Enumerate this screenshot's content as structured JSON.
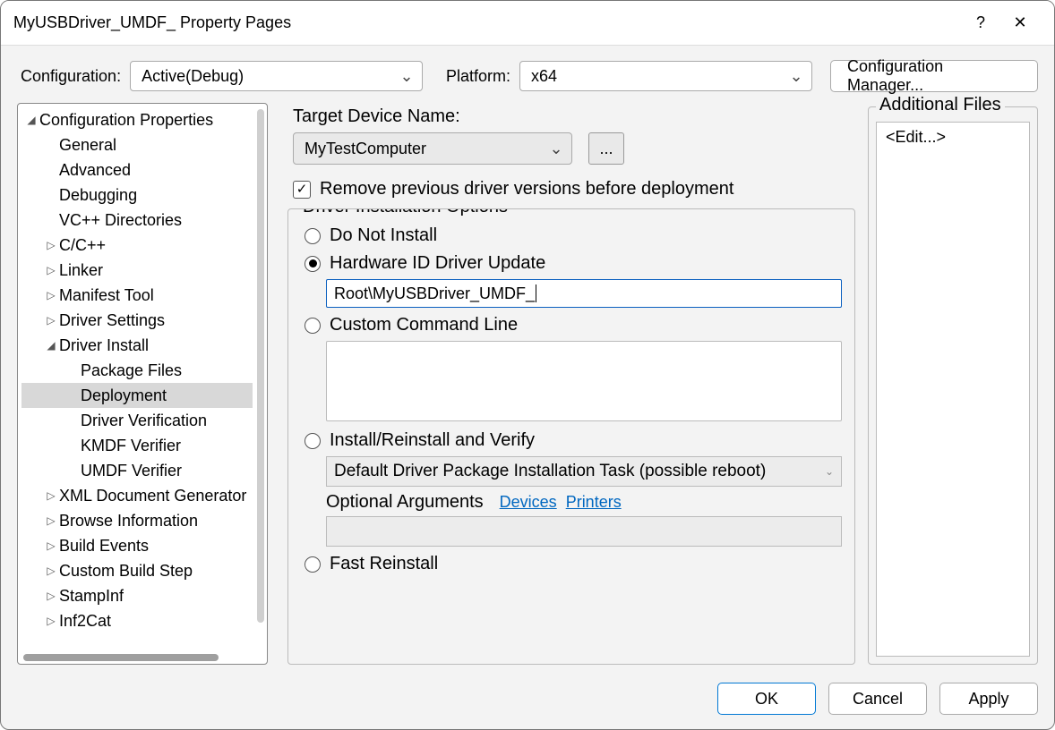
{
  "window": {
    "title": "MyUSBDriver_UMDF_ Property Pages"
  },
  "top": {
    "configuration_label": "Configuration:",
    "configuration_value": "Active(Debug)",
    "platform_label": "Platform:",
    "platform_value": "x64",
    "config_manager": "Configuration Manager..."
  },
  "tree": {
    "root": "Configuration Properties",
    "items": [
      {
        "label": "General",
        "lvl": 1,
        "exp": false,
        "leaf": true
      },
      {
        "label": "Advanced",
        "lvl": 1,
        "exp": false,
        "leaf": true
      },
      {
        "label": "Debugging",
        "lvl": 1,
        "exp": false,
        "leaf": true
      },
      {
        "label": "VC++ Directories",
        "lvl": 1,
        "exp": false,
        "leaf": true
      },
      {
        "label": "C/C++",
        "lvl": 1,
        "exp": false,
        "leaf": false
      },
      {
        "label": "Linker",
        "lvl": 1,
        "exp": false,
        "leaf": false
      },
      {
        "label": "Manifest Tool",
        "lvl": 1,
        "exp": false,
        "leaf": false
      },
      {
        "label": "Driver Settings",
        "lvl": 1,
        "exp": false,
        "leaf": false
      },
      {
        "label": "Driver Install",
        "lvl": 1,
        "exp": true,
        "leaf": false
      },
      {
        "label": "Package Files",
        "lvl": 2,
        "exp": false,
        "leaf": true
      },
      {
        "label": "Deployment",
        "lvl": 2,
        "exp": false,
        "leaf": true,
        "selected": true
      },
      {
        "label": "Driver Verification",
        "lvl": 2,
        "exp": false,
        "leaf": true
      },
      {
        "label": "KMDF Verifier",
        "lvl": 2,
        "exp": false,
        "leaf": true
      },
      {
        "label": "UMDF Verifier",
        "lvl": 2,
        "exp": false,
        "leaf": true
      },
      {
        "label": "XML Document Generator",
        "lvl": 1,
        "exp": false,
        "leaf": false
      },
      {
        "label": "Browse Information",
        "lvl": 1,
        "exp": false,
        "leaf": false
      },
      {
        "label": "Build Events",
        "lvl": 1,
        "exp": false,
        "leaf": false
      },
      {
        "label": "Custom Build Step",
        "lvl": 1,
        "exp": false,
        "leaf": false
      },
      {
        "label": "StampInf",
        "lvl": 1,
        "exp": false,
        "leaf": false
      },
      {
        "label": "Inf2Cat",
        "lvl": 1,
        "exp": false,
        "leaf": false
      }
    ]
  },
  "form": {
    "target_device_label": "Target Device Name:",
    "target_device_value": "MyTestComputer",
    "ellipsis": "...",
    "remove_prev_label": "Remove previous driver versions before deployment",
    "remove_prev_checked": true,
    "options_legend": "Driver Installation Options",
    "radios": {
      "do_not_install": "Do Not Install",
      "hwid_update": "Hardware ID Driver Update",
      "hwid_value": "Root\\MyUSBDriver_UMDF_",
      "custom_cmd": "Custom Command Line",
      "install_verify": "Install/Reinstall and Verify",
      "install_verify_value": "Default Driver Package Installation Task (possible reboot)",
      "optargs_label": "Optional Arguments",
      "devices_link": "Devices",
      "printers_link": "Printers",
      "fast_reinstall": "Fast Reinstall"
    }
  },
  "addfiles": {
    "legend": "Additional Files",
    "edit": "<Edit...>"
  },
  "buttons": {
    "ok": "OK",
    "cancel": "Cancel",
    "apply": "Apply"
  }
}
